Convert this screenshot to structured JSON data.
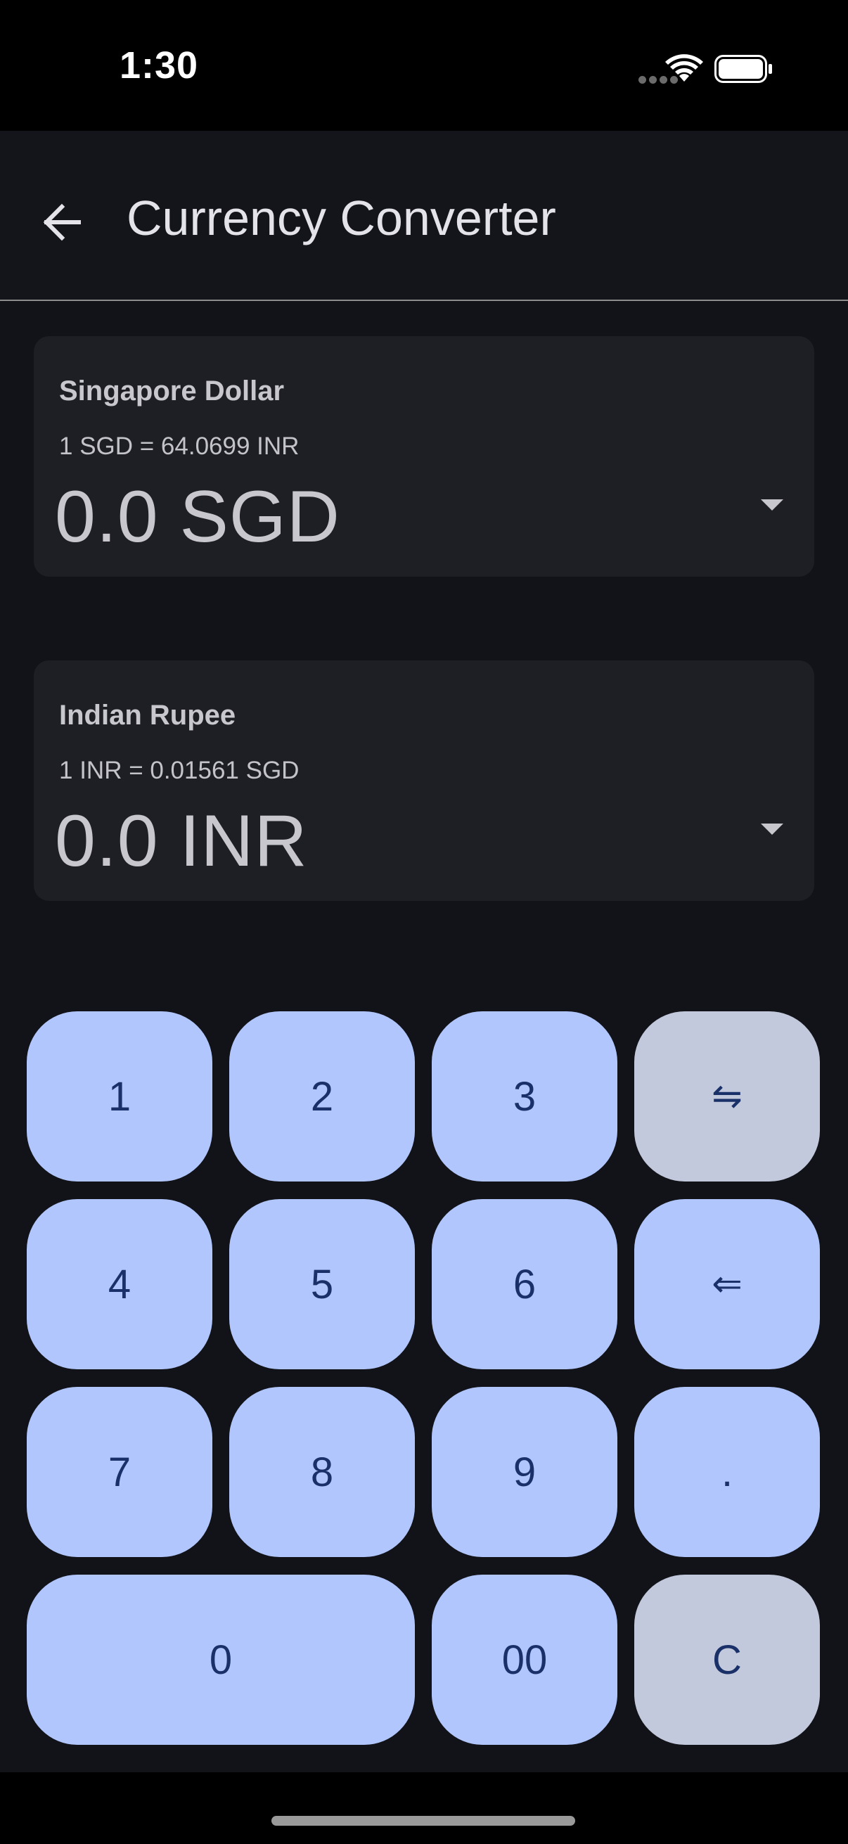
{
  "status_bar": {
    "time": "1:30",
    "icons": [
      "cellular-dots-icon",
      "wifi-icon",
      "battery-icon"
    ]
  },
  "app_bar": {
    "title": "Currency Converter",
    "back_icon": "back-arrow-icon"
  },
  "from_currency": {
    "name": "Singapore Dollar",
    "rate": "1 SGD = 64.0699 INR",
    "amount": "0.0 SGD"
  },
  "to_currency": {
    "name": "Indian Rupee",
    "rate": "1 INR = 0.01561 SGD",
    "amount": "0.0 INR"
  },
  "keypad": {
    "k1": "1",
    "k2": "2",
    "k3": "3",
    "swap": "⇋",
    "k4": "4",
    "k5": "5",
    "k6": "6",
    "backspace": "⇐",
    "k7": "7",
    "k8": "8",
    "k9": "9",
    "dot": ".",
    "k0": "0",
    "k00": "00",
    "clear": "C"
  },
  "colors": {
    "key_primary": "#b1c6fd",
    "key_secondary": "#c3c9dc",
    "key_text": "#1a3068",
    "card_bg": "#1e1f25",
    "app_bg": "#121318"
  }
}
